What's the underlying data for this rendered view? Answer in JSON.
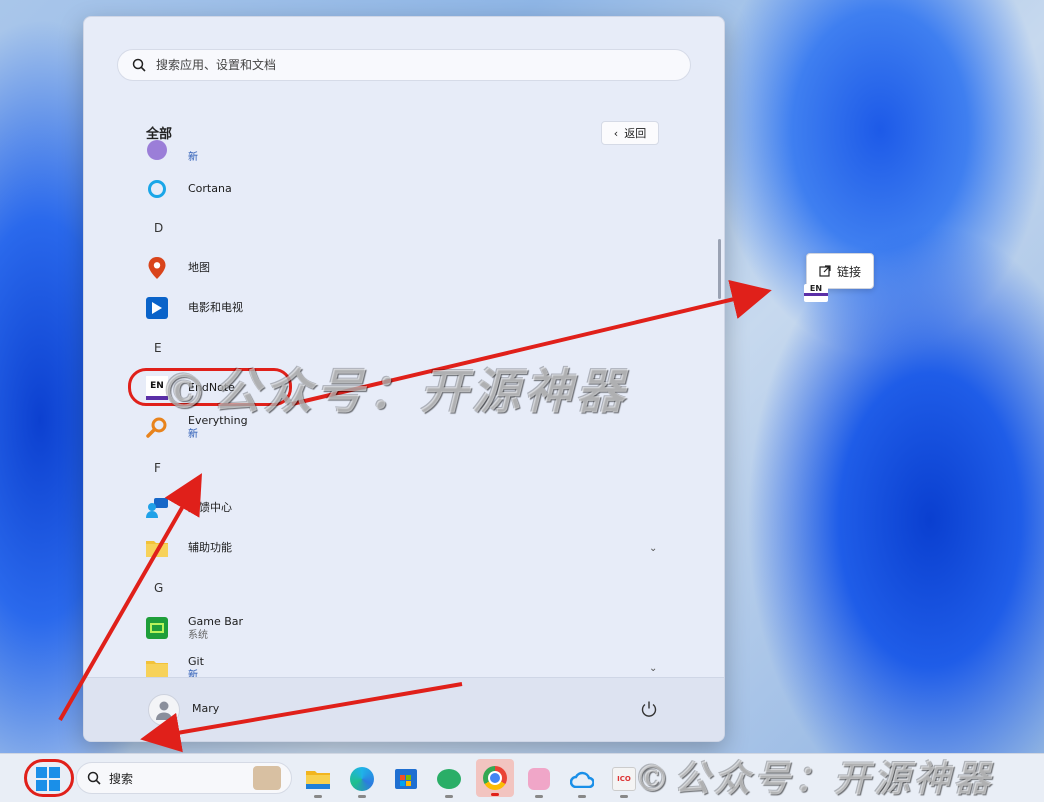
{
  "search": {
    "placeholder": "搜索应用、设置和文档"
  },
  "all_apps": {
    "title": "全部",
    "back_label": "返回"
  },
  "apps": [
    {
      "name": "",
      "sub": "新"
    },
    {
      "name": "Cortana"
    },
    {
      "letter": "D"
    },
    {
      "name": "地图"
    },
    {
      "name": "电影和电视"
    },
    {
      "letter": "E"
    },
    {
      "name": "EndNote",
      "icon_text": "EN"
    },
    {
      "name": "Everything",
      "sub": "新"
    },
    {
      "letter": "F"
    },
    {
      "name": "反馈中心"
    },
    {
      "name": "辅助功能"
    },
    {
      "letter": "G"
    },
    {
      "name": "Game Bar",
      "sub": "系统"
    },
    {
      "name": "Git",
      "sub": "新"
    }
  ],
  "user": {
    "name": "Mary"
  },
  "tooltip": {
    "label": "链接",
    "drag_icon_text": "EN"
  },
  "taskbar": {
    "search_label": "搜索",
    "apps": [
      "file-explorer",
      "edge",
      "store",
      "wechat",
      "chrome",
      "cat-app",
      "cloud-app",
      "ico-app",
      "unknown-app"
    ]
  },
  "watermark": {
    "text": "©公众号：开源神器"
  },
  "colors": {
    "accent": "#0067c0",
    "annotation_red": "#e0201a"
  }
}
